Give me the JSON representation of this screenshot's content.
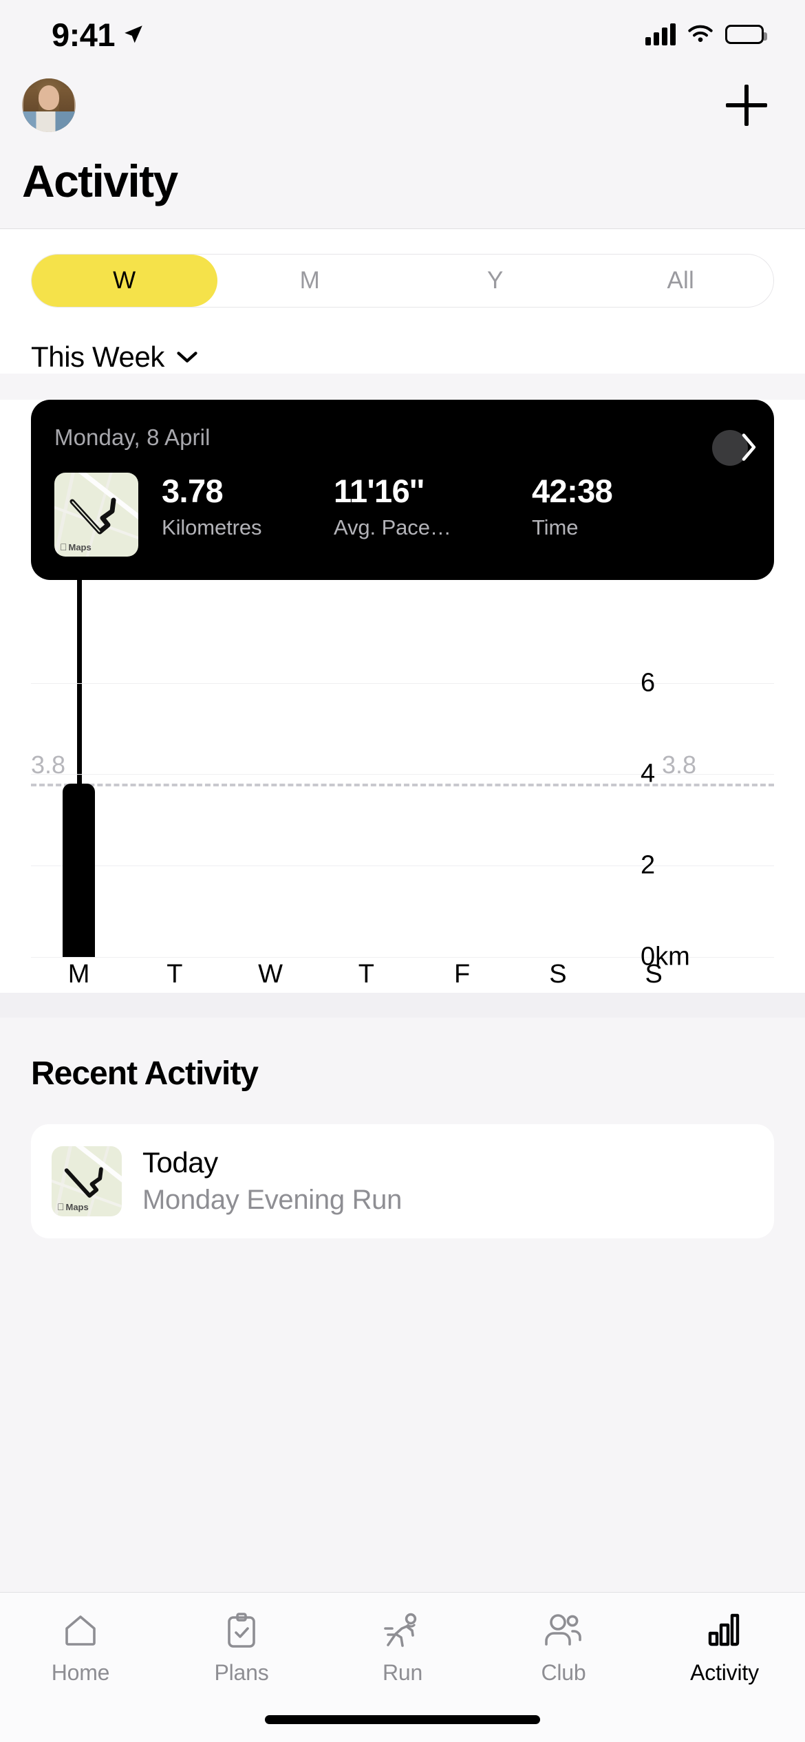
{
  "status_bar": {
    "time": "9:41",
    "location_icon": "location-arrow-icon",
    "cellular_icon": "cellular-bars-icon",
    "wifi_icon": "wifi-icon",
    "battery_icon": "battery-full-icon"
  },
  "header": {
    "avatar": "user-avatar",
    "add_label": "+",
    "title": "Activity"
  },
  "segmented": {
    "options": [
      {
        "label": "W",
        "selected": true
      },
      {
        "label": "M",
        "selected": false
      },
      {
        "label": "Y",
        "selected": false
      },
      {
        "label": "All",
        "selected": false
      }
    ],
    "accent_color": "#f5e24a"
  },
  "range_selector": {
    "label": "This Week",
    "chevron": "chevron-down-icon"
  },
  "summary_card": {
    "date": "Monday, 8 April",
    "map_watermark": "Maps",
    "disclosure": "chevron-right-icon",
    "stats": [
      {
        "value": "3.78",
        "label": "Kilometres"
      },
      {
        "value": "11'16''",
        "label": "Avg. Pace…"
      },
      {
        "value": "42:38",
        "label": "Time"
      }
    ],
    "background_color": "#000000"
  },
  "chart_data": {
    "type": "bar",
    "title": "",
    "xlabel": "",
    "ylabel": "km",
    "categories": [
      "M",
      "T",
      "W",
      "T",
      "F",
      "S",
      "S"
    ],
    "values": [
      3.8,
      0,
      0,
      0,
      0,
      0,
      0
    ],
    "ylim": [
      0,
      6
    ],
    "yticks": [
      0,
      2,
      4,
      6
    ],
    "ytick_labels": [
      "0km",
      "2",
      "4",
      "6"
    ],
    "grid": true,
    "legend": "none",
    "average_line": {
      "value": 3.8,
      "label_left": "3.8",
      "label_right": "3.8",
      "style": "dashed",
      "color": "#c9c9ce"
    },
    "bar_color": "#000000",
    "highlighted_index": 0
  },
  "recent": {
    "heading": "Recent Activity",
    "items": [
      {
        "map_watermark": "Maps",
        "title": "Today",
        "subtitle": "Monday Evening Run"
      }
    ]
  },
  "tabbar": {
    "items": [
      {
        "label": "Home",
        "icon": "home-icon",
        "active": false
      },
      {
        "label": "Plans",
        "icon": "clipboard-check-icon",
        "active": false
      },
      {
        "label": "Run",
        "icon": "running-person-icon",
        "active": false
      },
      {
        "label": "Club",
        "icon": "people-icon",
        "active": false
      },
      {
        "label": "Activity",
        "icon": "bar-chart-icon",
        "active": true
      }
    ]
  }
}
